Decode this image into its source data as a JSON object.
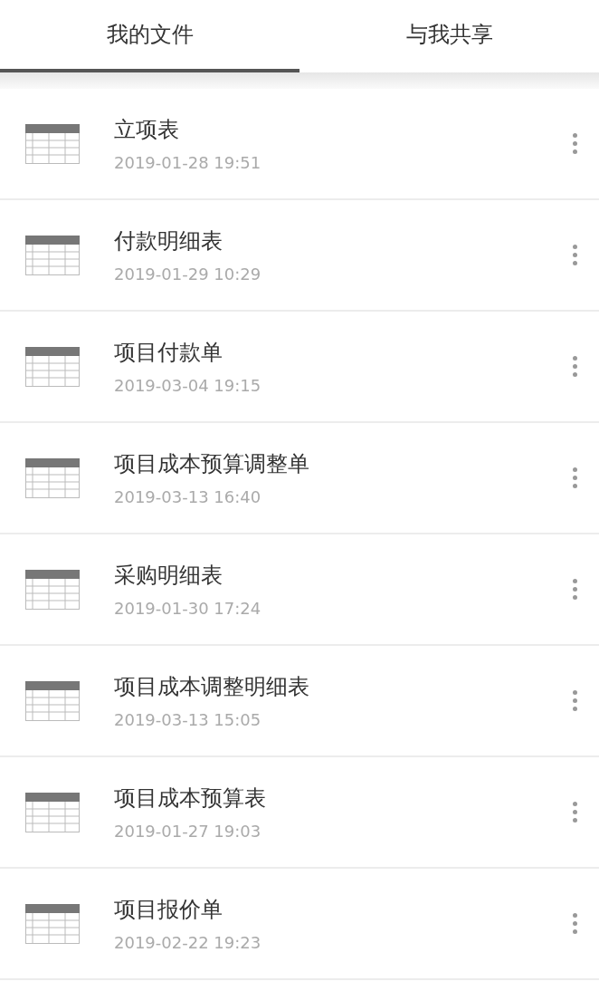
{
  "tabs": [
    {
      "label": "我的文件",
      "selected": true
    },
    {
      "label": "与我共享",
      "selected": false
    }
  ],
  "files": [
    {
      "name": "立项表",
      "time": "2019-01-28 19:51"
    },
    {
      "name": "付款明细表",
      "time": "2019-01-29 10:29"
    },
    {
      "name": "项目付款单",
      "time": "2019-03-04 19:15"
    },
    {
      "name": "项目成本预算调整单",
      "time": "2019-03-13 16:40"
    },
    {
      "name": "采购明细表",
      "time": "2019-01-30 17:24"
    },
    {
      "name": "项目成本调整明细表",
      "time": "2019-03-13 15:05"
    },
    {
      "name": "项目成本预算表",
      "time": "2019-01-27 19:03"
    },
    {
      "name": "项目报价单",
      "time": "2019-02-22 19:23"
    }
  ]
}
